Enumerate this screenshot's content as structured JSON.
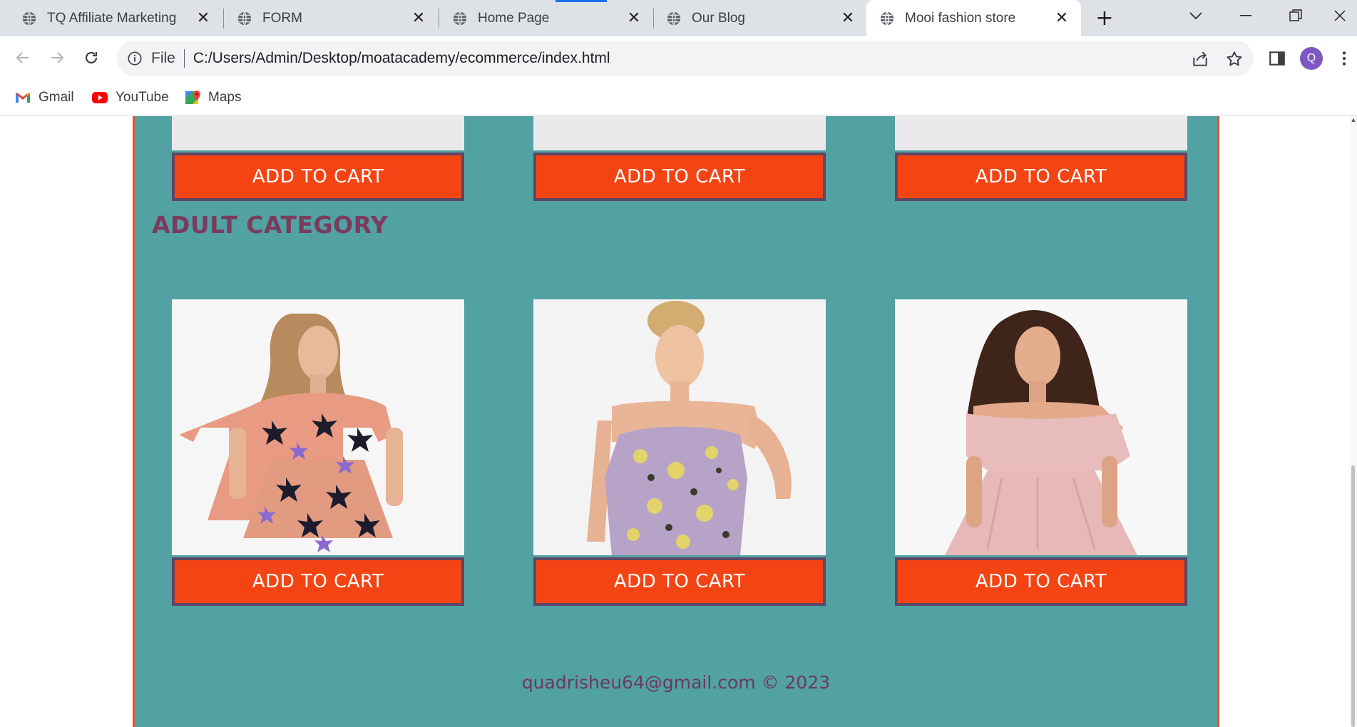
{
  "browser": {
    "tabs": [
      {
        "title": "TQ Affiliate Marketing",
        "active": false
      },
      {
        "title": "FORM",
        "active": false
      },
      {
        "title": "Home Page",
        "active": false
      },
      {
        "title": "Our Blog",
        "active": false
      },
      {
        "title": "Mooi fashion store",
        "active": true
      }
    ],
    "omnibox": {
      "scheme_label": "File",
      "url": "C:/Users/Admin/Desktop/moatacademy/ecommerce/index.html"
    },
    "profile_initial": "Q",
    "bookmarks": [
      {
        "label": "Gmail",
        "icon": "gmail-icon"
      },
      {
        "label": "YouTube",
        "icon": "youtube-icon"
      },
      {
        "label": "Maps",
        "icon": "maps-icon"
      }
    ]
  },
  "page": {
    "top_row": {
      "buttons": [
        "ADD TO CART",
        "ADD TO CART",
        "ADD TO CART"
      ]
    },
    "adult_category": {
      "heading": "ADULT CATEGORY",
      "products": [
        {
          "image": "dress-star-print-photo",
          "button": "ADD TO CART"
        },
        {
          "image": "dress-floral-strapless-photo",
          "button": "ADD TO CART"
        },
        {
          "image": "dress-pink-off-shoulder-photo",
          "button": "ADD TO CART"
        }
      ]
    },
    "footer": "quadrisheu64@gmail.com © 2023"
  },
  "colors": {
    "store_bg": "#52a1a3",
    "button_bg": "#f44414",
    "button_border": "#5e4666",
    "heading": "#7a3b5c",
    "frame_border": "#e75427"
  }
}
